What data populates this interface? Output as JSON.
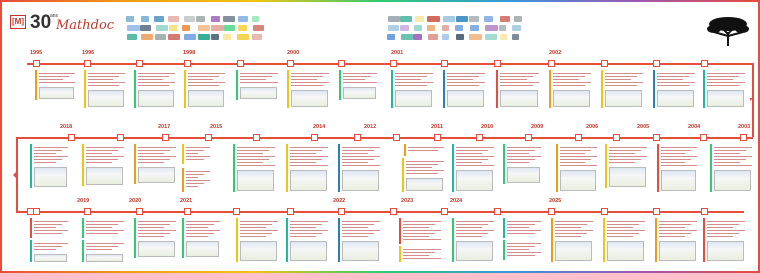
{
  "header": {
    "logo_box": "[M]",
    "logo_number": "30",
    "logo_superscript": "ans",
    "logo_title": "Mathdoc",
    "subtitle": ""
  },
  "rows": [
    {
      "years": [
        "1995",
        "1996",
        "1998",
        "2000",
        "2001",
        "2002"
      ]
    },
    {
      "years": [
        "2018",
        "2017",
        "2015",
        "2014",
        "2012",
        "2011",
        "2010",
        "2009",
        "2006",
        "2005",
        "2004",
        "2003"
      ]
    },
    {
      "years": [
        "2019",
        "2020",
        "2021",
        "2022",
        "2023",
        "2024",
        "2025"
      ]
    }
  ],
  "colors": {
    "timeline": "#e74c3c",
    "accent_green": "#2ecc71",
    "accent_orange": "#f39c12",
    "accent_yellow": "#f1c40f",
    "accent_teal": "#1abc9c",
    "accent_blue": "#2980b9",
    "accent_red": "#e74c3c"
  }
}
